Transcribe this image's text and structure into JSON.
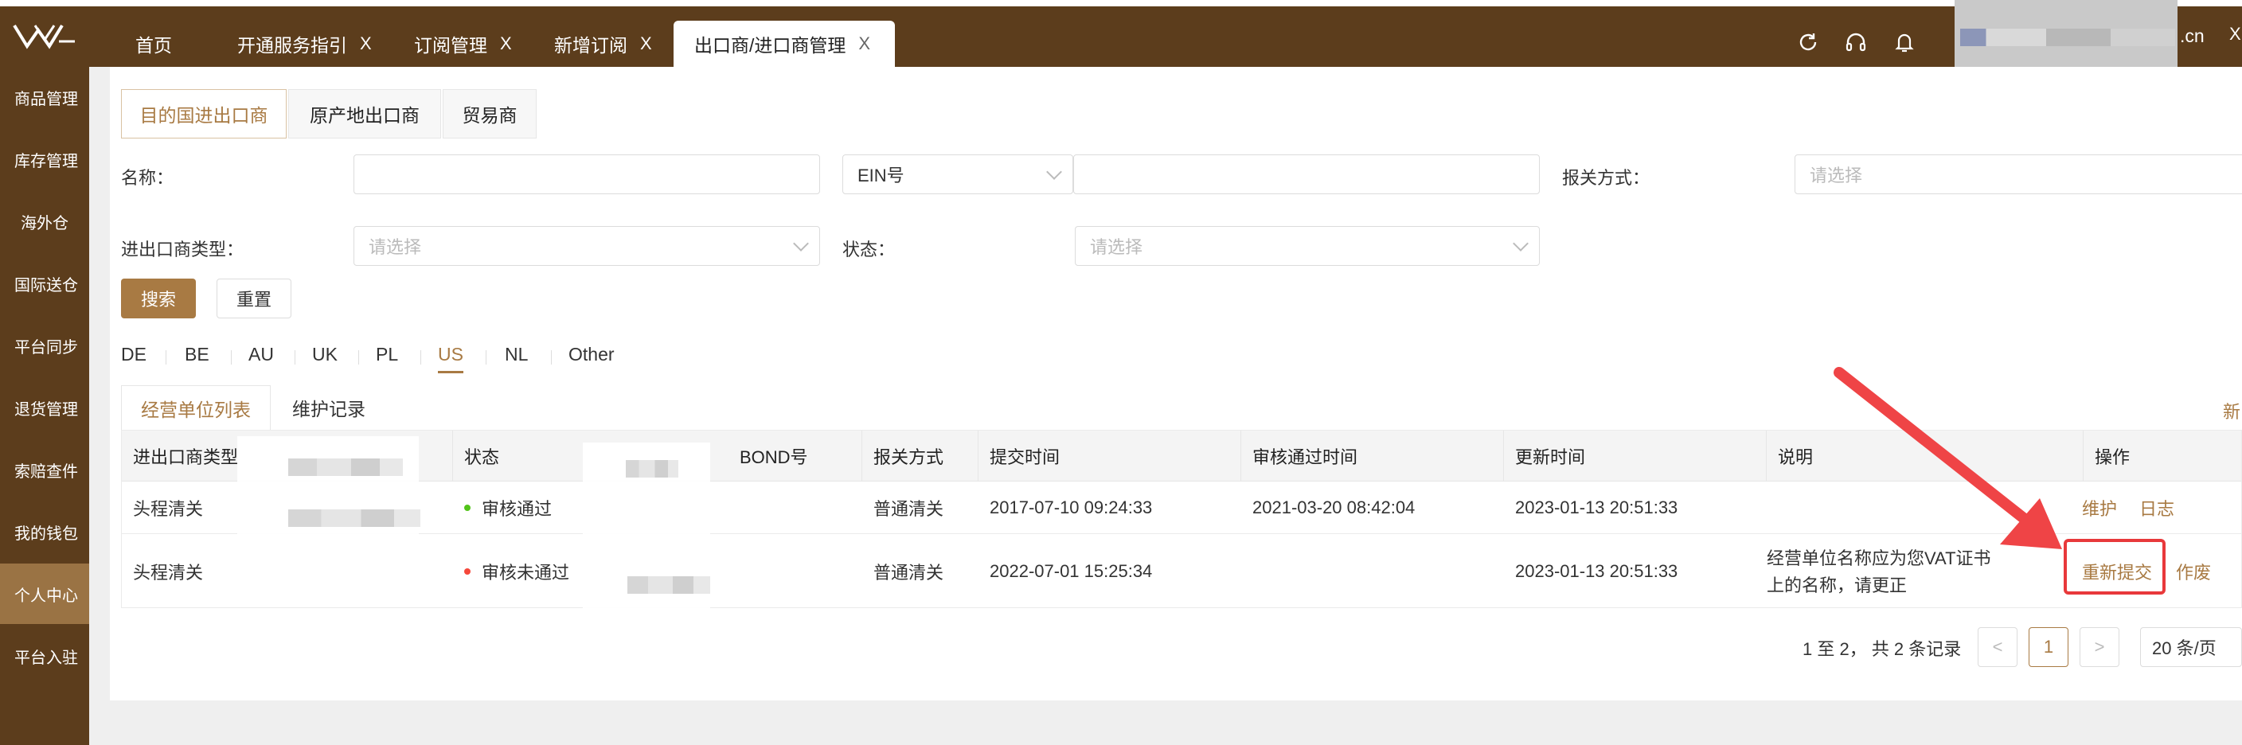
{
  "header": {
    "tabs": [
      {
        "label": "首页"
      },
      {
        "label": "开通服务指引",
        "close": "X"
      },
      {
        "label": "订阅管理",
        "close": "X"
      },
      {
        "label": "新增订阅",
        "close": "X"
      },
      {
        "label": "出口商/进口商管理",
        "close": "X",
        "active": true
      }
    ],
    "user_suffix": ".cn",
    "edge_text": "X",
    "icons": [
      "refresh-icon",
      "headset-icon",
      "bell-icon"
    ]
  },
  "sidebar": {
    "items": [
      {
        "label": "商品管理"
      },
      {
        "label": "库存管理"
      },
      {
        "label": "海外仓"
      },
      {
        "label": "国际送仓"
      },
      {
        "label": "平台同步"
      },
      {
        "label": "退货管理"
      },
      {
        "label": "索赔查件"
      },
      {
        "label": "我的钱包"
      },
      {
        "label": "个人中心",
        "active": true
      },
      {
        "label": "平台入驻"
      }
    ]
  },
  "subtabs": [
    "目的国进出口商",
    "原产地出口商",
    "贸易商"
  ],
  "filters": {
    "name_label": "名称：",
    "ein_select": "EIN号",
    "customs_label": "报关方式：",
    "customs_placeholder": "请选择",
    "type_label": "进出口商类型：",
    "type_placeholder": "请选择",
    "status_label": "状态：",
    "status_placeholder": "请选择",
    "search_button": "搜索",
    "reset_button": "重置"
  },
  "countries": [
    "DE",
    "BE",
    "AU",
    "UK",
    "PL",
    "US",
    "NL",
    "Other"
  ],
  "active_country": "US",
  "list_tabs": [
    "经营单位列表",
    "维护记录"
  ],
  "right_edge_text": "新",
  "table": {
    "headers": [
      "进出口商类型",
      "状态",
      "BOND号",
      "报关方式",
      "提交时间",
      "审核通过时间",
      "更新时间",
      "说明",
      "操作"
    ],
    "rows": [
      {
        "type": "头程清关",
        "status": "审核通过",
        "status_color": "#52c41a",
        "bond": "",
        "customs": "普通清关",
        "submitted": "2017-07-10 09:24:33",
        "approved": "2021-03-20 08:42:04",
        "updated": "2023-01-13 20:51:33",
        "note": "",
        "actions": [
          "维护",
          "日志"
        ]
      },
      {
        "type": "头程清关",
        "status": "审核未通过",
        "status_color": "#f5483b",
        "bond": "",
        "customs": "普通清关",
        "submitted": "2022-07-01 15:25:34",
        "approved": "",
        "updated": "2023-01-13 20:51:33",
        "note_line1": "经营单位名称应为您VAT证书",
        "note_line2": "上的名称，请更正",
        "actions": [
          "重新提交",
          "作废"
        ]
      }
    ]
  },
  "pagination": {
    "info": "1 至 2， 共 2 条记录",
    "prev": "<",
    "current": "1",
    "next": ">",
    "page_size": "20 条/页"
  },
  "colors": {
    "brand": "#5c3d1c",
    "accent": "#a87a43",
    "highlight": "#e8393b"
  }
}
